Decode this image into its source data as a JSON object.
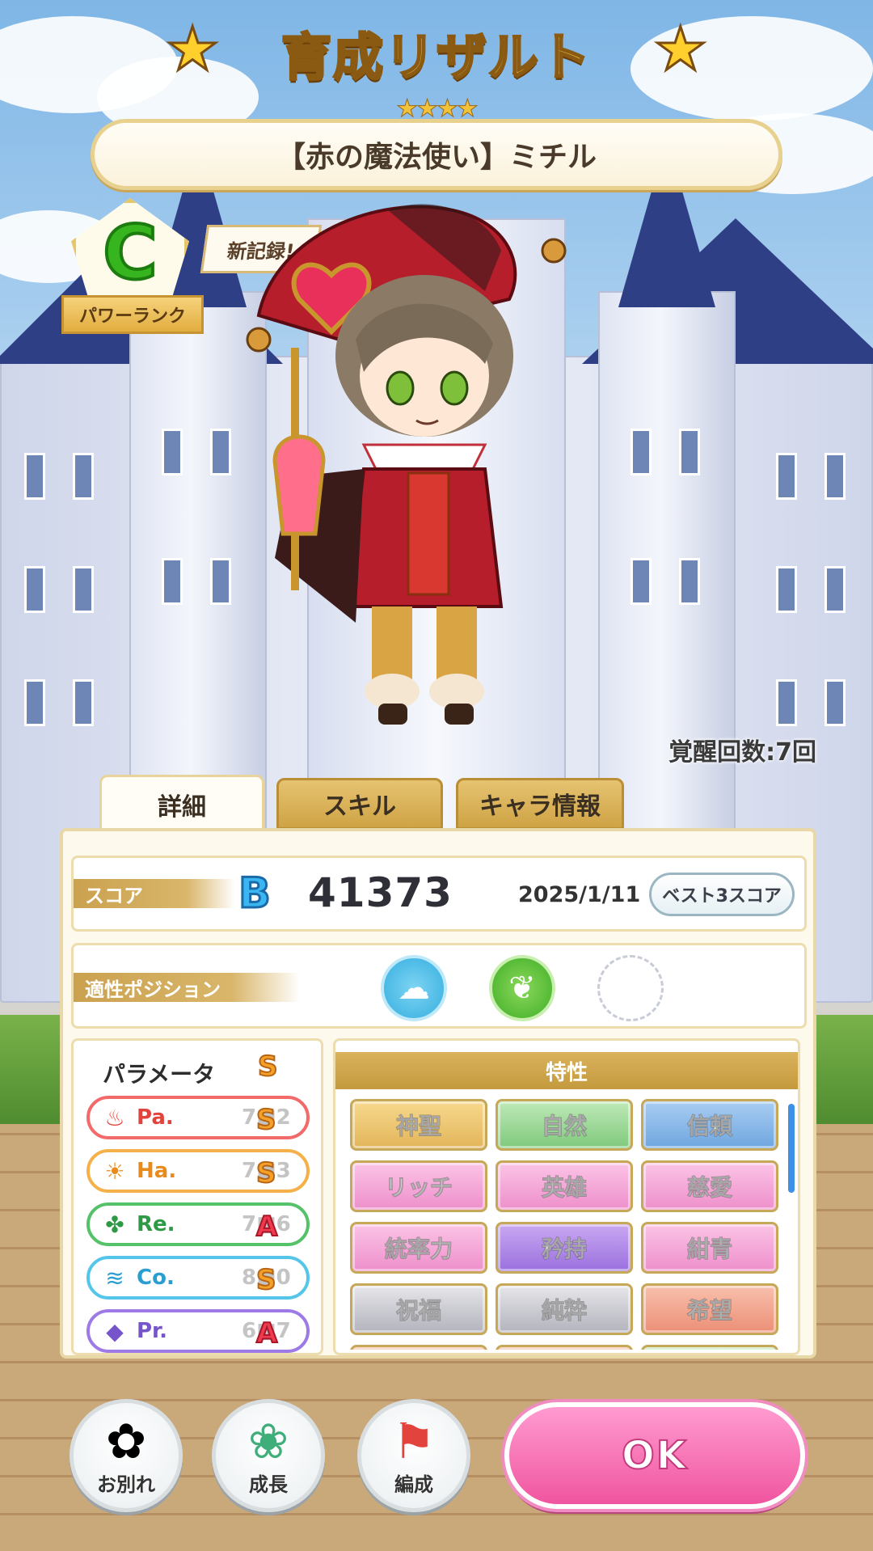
{
  "header": {
    "title": "育成リザルト",
    "rarity_stars": "★★★★",
    "character_name": "【赤の魔法使い】ミチル"
  },
  "power_rank": {
    "grade": "C",
    "label": "パワーランク",
    "new_record": "新記録!"
  },
  "awakening": "覚醒回数:7回",
  "tabs": [
    {
      "label": "詳細",
      "active": true
    },
    {
      "label": "スキル",
      "active": false
    },
    {
      "label": "キャラ情報",
      "active": false
    }
  ],
  "score": {
    "label": "スコア",
    "grade": "B",
    "value": "41373",
    "date": "2025/1/11",
    "best_button": "ベスト3スコア"
  },
  "positions": {
    "label": "適性ポジション",
    "icons": [
      "wind-position-icon",
      "nature-position-icon",
      "empty-slot"
    ]
  },
  "parameters": {
    "title": "パラメータ",
    "overall_grade": "S",
    "rows": [
      {
        "name": "Pa.",
        "value": "7■2",
        "grade": "S",
        "color": "#e2433d",
        "icon": "flame-icon"
      },
      {
        "name": "Ha.",
        "value": "7■3",
        "grade": "S",
        "color": "#e88b1c",
        "icon": "sun-icon"
      },
      {
        "name": "Re.",
        "value": "7■6",
        "grade": "A",
        "color": "#2f9a46",
        "icon": "clover-icon"
      },
      {
        "name": "Co.",
        "value": "8■0",
        "grade": "S",
        "color": "#2a9ed0",
        "icon": "wave-icon"
      },
      {
        "name": "Pr.",
        "value": "6■7",
        "grade": "A",
        "color": "#7654c9",
        "icon": "diamond-icon"
      }
    ]
  },
  "traits": {
    "title": "特性",
    "items": [
      {
        "label": "神聖",
        "style": "gold"
      },
      {
        "label": "自然",
        "style": "green"
      },
      {
        "label": "信頼",
        "style": "blue"
      },
      {
        "label": "リッチ",
        "style": "pink"
      },
      {
        "label": "英雄",
        "style": "pink"
      },
      {
        "label": "慈愛",
        "style": "pink"
      },
      {
        "label": "統率力",
        "style": "pink"
      },
      {
        "label": "矜持",
        "style": "purple"
      },
      {
        "label": "紺青",
        "style": "pink"
      },
      {
        "label": "祝福",
        "style": "silver"
      },
      {
        "label": "純粋",
        "style": "silver"
      },
      {
        "label": "希望",
        "style": "salmon"
      }
    ]
  },
  "bottom_buttons": [
    {
      "label": "お別れ",
      "icon": "flower-icon"
    },
    {
      "label": "成長",
      "icon": "sprout-icon"
    },
    {
      "label": "編成",
      "icon": "crossed-flags-icon"
    }
  ],
  "ok_button": "OK"
}
